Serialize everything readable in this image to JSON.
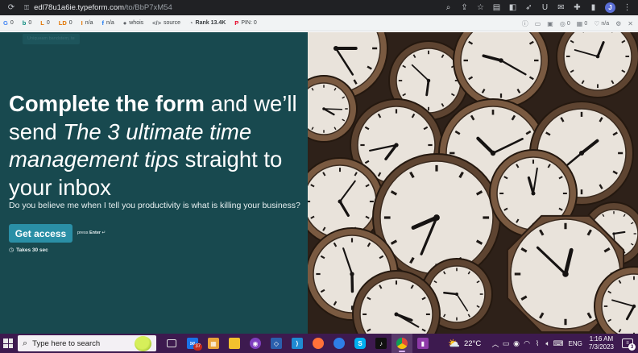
{
  "browser": {
    "url_host": "edl78u1a6ie.typeform.com",
    "url_path": "/to/BbP7xM54",
    "profile_initial": "J"
  },
  "seo_toolbar": {
    "items": [
      {
        "icon": "G",
        "value": "0"
      },
      {
        "icon": "b",
        "value": "0"
      },
      {
        "icon": "L",
        "value": "0"
      },
      {
        "icon": "LD",
        "value": "0"
      },
      {
        "icon": "I",
        "value": "n/a"
      },
      {
        "icon": "f",
        "value": "n/a"
      },
      {
        "icon": "",
        "value": "whois"
      },
      {
        "icon": "</>",
        "value": "source"
      },
      {
        "icon": "",
        "value": "Rank 13.4K"
      },
      {
        "icon": "P",
        "value": "PIN: 0"
      }
    ],
    "right_items": [
      {
        "value": "0"
      },
      {
        "value": "0"
      },
      {
        "value": "n/a"
      }
    ],
    "colors": {
      "google": "#4285f4",
      "bing": "#0a8a7d",
      "links": "#e37400",
      "ld": "#e37400",
      "ig": "#e37400",
      "fb": "#1877f2",
      "pin": "#e60023"
    }
  },
  "form": {
    "ghost_tag": "Uniqueam bandotem, te",
    "headline": {
      "part1": "Complete the form",
      "part2": " and we’ll send ",
      "part3": "The 3 ultimate time management tips",
      "part4": " straight to your inbox"
    },
    "question": "Do you believe me when I tell you productivity is what is killing your business?",
    "cta_label": "Get access",
    "hint_prefix": "press ",
    "hint_key": "Enter",
    "hint_icon": "↵",
    "time_estimate": "Takes 30 sec",
    "colors": {
      "background": "#18494f",
      "button": "#2a8fa6"
    }
  },
  "taskbar": {
    "search_placeholder": "Type here to search",
    "mail_badge": "37",
    "weather": "22°C",
    "lang": "ENG",
    "time": "1:16 AM",
    "date": "7/3/2023",
    "notifications": "3",
    "apps": [
      {
        "name": "task-view",
        "label": ""
      },
      {
        "name": "mail",
        "label": "",
        "color": "#1a73e8"
      },
      {
        "name": "store",
        "label": "",
        "color": "#e8a33a"
      },
      {
        "name": "file-explorer",
        "label": "",
        "color": "#f2c12e"
      },
      {
        "name": "github-desktop",
        "label": "",
        "color": "#7f3fbf"
      },
      {
        "name": "virtualbox",
        "label": "",
        "color": "#2b5fad"
      },
      {
        "name": "vscode",
        "label": "",
        "color": "#1f8ad2"
      },
      {
        "name": "firefox",
        "label": "",
        "color": "#ff7139"
      },
      {
        "name": "firefox-dev",
        "label": "",
        "color": "#2e7ee8"
      },
      {
        "name": "skype",
        "label": "S",
        "color": "#00aff0"
      },
      {
        "name": "tiktok",
        "label": "♪",
        "color": "#111111"
      },
      {
        "name": "chrome",
        "label": "",
        "color": "#dd4b39"
      },
      {
        "name": "pin-app",
        "label": "",
        "color": "#8e3aa8"
      }
    ]
  }
}
